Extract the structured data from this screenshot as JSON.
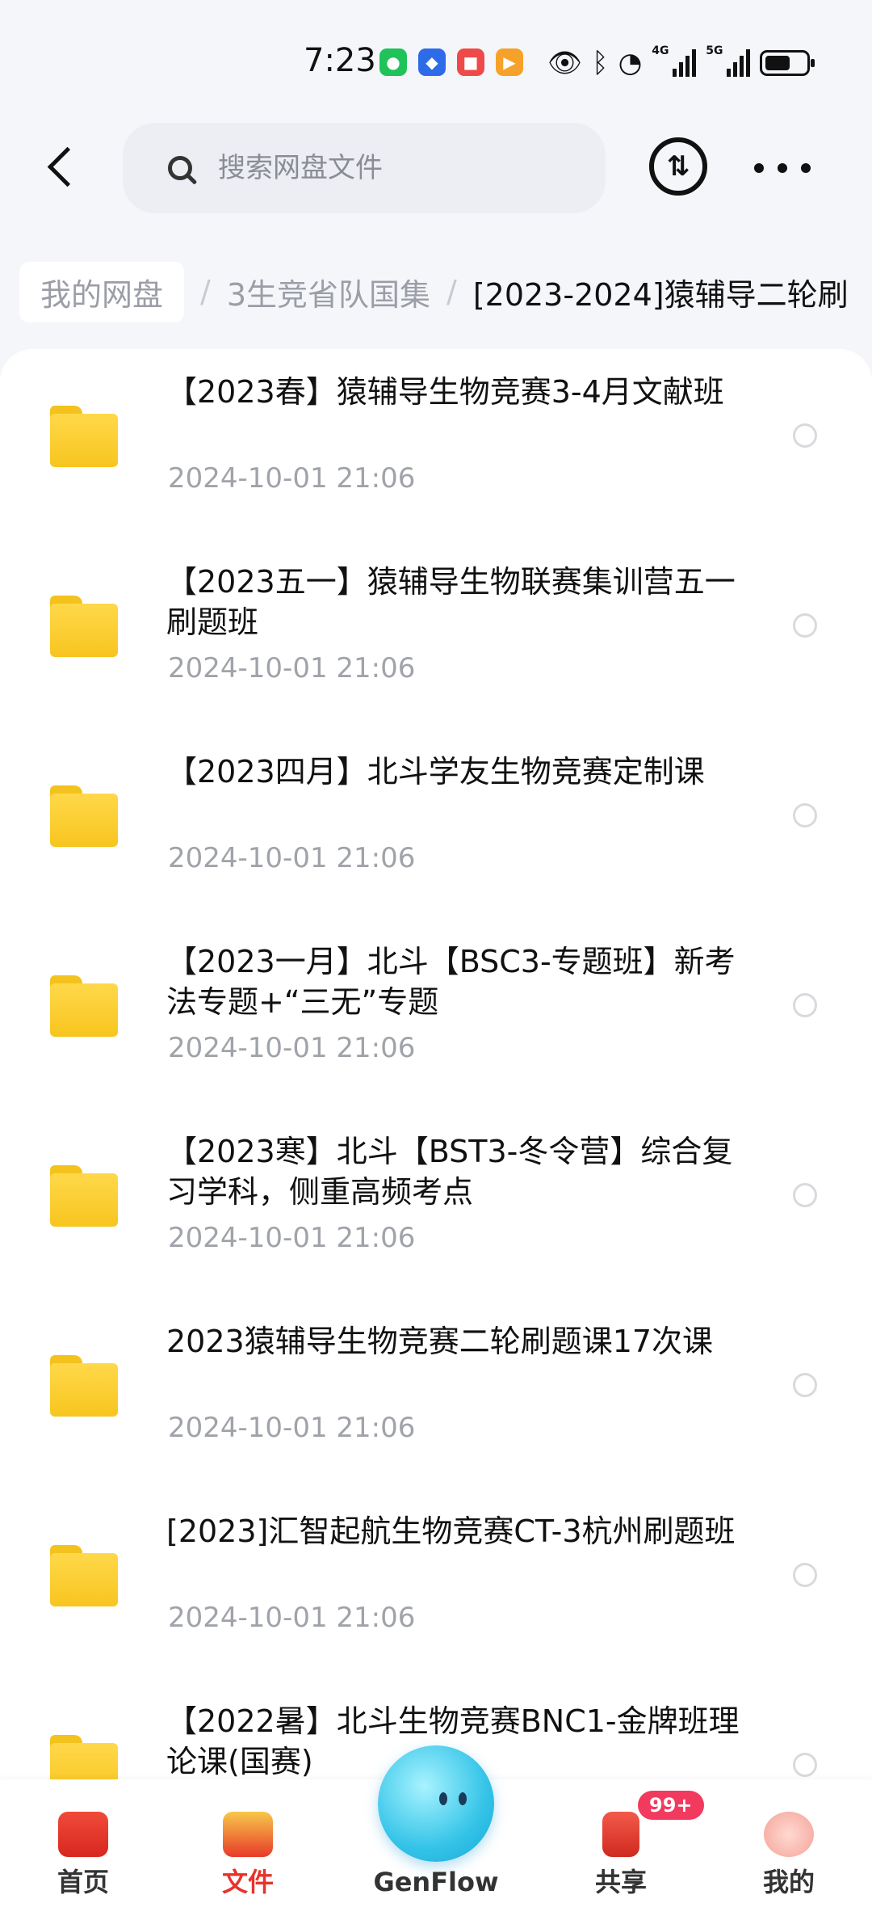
{
  "status_bar": {
    "time": "7:23",
    "network_1": "4G",
    "network_2": "5G"
  },
  "header": {
    "search_placeholder": "搜索网盘文件",
    "transfer_icon": "⇅"
  },
  "breadcrumb": {
    "items": [
      "我的网盘",
      "3生竞省队国集",
      "[2023-2024]猿辅导二轮刷"
    ]
  },
  "files": [
    {
      "name": "【2023春】猿辅导生物竞赛3-4月文献班",
      "date": "2024-10-01  21:06"
    },
    {
      "name": "【2023五一】猿辅导生物联赛集训营五一刷题班",
      "date": "2024-10-01  21:06"
    },
    {
      "name": "【2023四月】北斗学友生物竞赛定制课",
      "date": "2024-10-01  21:06"
    },
    {
      "name": "【2023一月】北斗【BSC3-专题班】新考法专题+“三无”专题",
      "date": "2024-10-01  21:06"
    },
    {
      "name": "【2023寒】北斗【BST3-冬令营】综合复习学科，侧重高频考点",
      "date": "2024-10-01  21:06"
    },
    {
      "name": "2023猿辅导生物竞赛二轮刷题课17次课",
      "date": "2024-10-01  21:06"
    },
    {
      "name": "[2023]汇智起航生物竞赛CT-3杭州刷题班",
      "date": "2024-10-01  21:06"
    },
    {
      "name": "【2022暑】北斗生物竞赛BNC1-金牌班理论课(国赛)",
      "date": ""
    }
  ],
  "bottom_nav": {
    "home": "首页",
    "files": "文件",
    "genflow": "GenFlow",
    "share": "共享",
    "mine": "我的",
    "share_badge": "99+"
  },
  "colors": {
    "accent": "#e8322b",
    "folder": "#f7c51e",
    "badge": "#f23a5e"
  }
}
